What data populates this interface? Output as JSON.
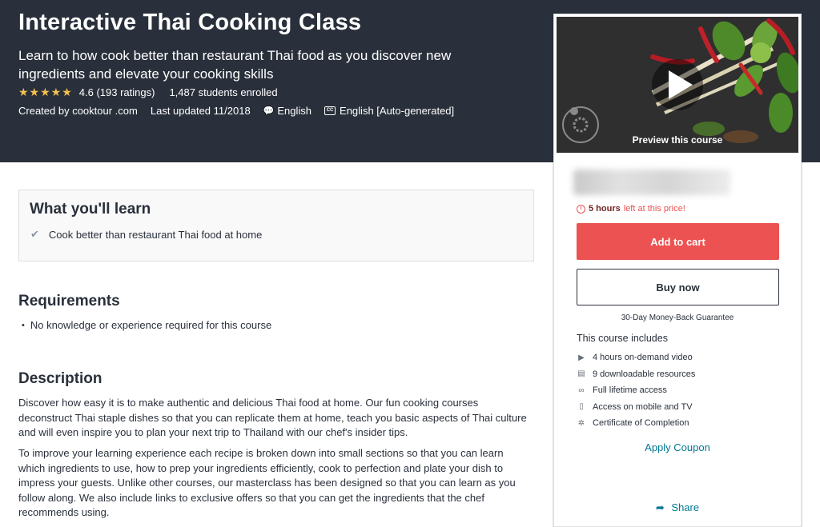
{
  "hero": {
    "title": "Interactive Thai Cooking Class",
    "subtitle": "Learn to how cook better than restaurant Thai food as you discover new ingredients and elevate your cooking skills",
    "stars": "★★★★★",
    "rating": "4.6 (193 ratings)",
    "students": "1,487 students enrolled",
    "created_by": "Created by cooktour .com",
    "last_updated": "Last updated 11/2018",
    "language": "English",
    "captions": "English [Auto-generated]",
    "cc_badge": "CC",
    "bubble_icon": "💬"
  },
  "sidebar": {
    "preview_label": "Preview this course",
    "time_left_hours": "5 hours",
    "time_left_suffix": "left at this price!",
    "add_to_cart": "Add to cart",
    "buy_now": "Buy now",
    "guarantee": "30-Day Money-Back Guarantee",
    "includes_title": "This course includes",
    "includes": [
      {
        "icon": "video-icon",
        "glyph": "▶",
        "label": "4 hours on-demand video"
      },
      {
        "icon": "file-icon",
        "glyph": "▤",
        "label": "9 downloadable resources"
      },
      {
        "icon": "infinity-icon",
        "glyph": "∞",
        "label": "Full lifetime access"
      },
      {
        "icon": "mobile-icon",
        "glyph": "▯",
        "label": "Access on mobile and TV"
      },
      {
        "icon": "certificate-icon",
        "glyph": "✲",
        "label": "Certificate of Completion"
      }
    ],
    "apply_coupon": "Apply Coupon",
    "share": "Share",
    "share_glyph": "➦"
  },
  "learn": {
    "title": "What you'll learn",
    "items": [
      "Cook better than restaurant Thai food at home"
    ],
    "check_glyph": "✔"
  },
  "requirements": {
    "title": "Requirements",
    "items": [
      "No knowledge or experience required for this course"
    ],
    "bullet": "•"
  },
  "description": {
    "title": "Description",
    "paragraphs": [
      "Discover how easy it is to make authentic and delicious Thai food at home. Our fun cooking courses deconstruct Thai staple dishes so that you can replicate them at home, teach you basic aspects of Thai culture and will even inspire you to plan your next trip to Thailand with our chef's insider tips.",
      "To improve your learning experience each recipe is broken down into small sections so that you can learn which ingredients to use, how to prep your ingredients efficiently, cook to perfection and plate your dish to impress your guests. Unlike other courses, our masterclass has been designed so that you can learn as you follow along. We also include links to exclusive offers so that you can get the ingredients that the chef recommends using."
    ]
  },
  "colors": {
    "hero_bg": "#29303b",
    "cart_red": "#ec5252",
    "star_yellow": "#f4c150",
    "link_teal": "#007791"
  }
}
